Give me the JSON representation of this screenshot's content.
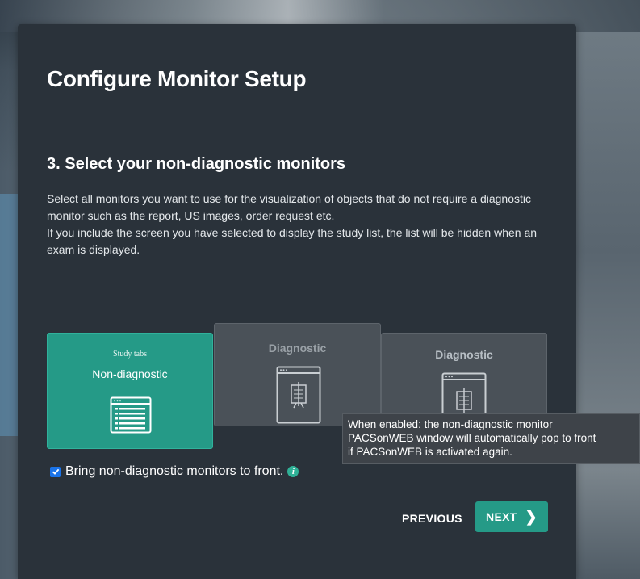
{
  "dialog": {
    "title": "Configure Monitor Setup",
    "step_title": "3. Select your non-diagnostic monitors",
    "description": [
      "Select all monitors you want to use for the visualization of objects that do not require a diagnostic monitor such as the report, US images, order request etc.",
      "If you include the screen you have selected to display the study list, the list will be hidden when an exam is displayed."
    ]
  },
  "monitors": [
    {
      "sublabel": "Study tabs",
      "label": "Non-diagnostic",
      "selected": true,
      "icon": "window-list-icon"
    },
    {
      "label": "Diagnostic",
      "selected": false,
      "icon": "window-xray-icon"
    },
    {
      "label": "Diagnostic",
      "selected": false,
      "icon": "window-xray-icon"
    }
  ],
  "bring_to_front": {
    "label": "Bring non-diagnostic monitors to front.",
    "checked": true,
    "info_icon": "info-icon"
  },
  "tooltip": {
    "lines": [
      "When enabled: the non-diagnostic monitor",
      "PACSonWEB window will automatically pop to front",
      "if PACSonWEB is activated again."
    ]
  },
  "buttons": {
    "previous": "PREVIOUS",
    "next": "NEXT"
  },
  "colors": {
    "accent": "#259a87",
    "dialog_bg": "#2a323a",
    "checkbox": "#1a73e8"
  }
}
